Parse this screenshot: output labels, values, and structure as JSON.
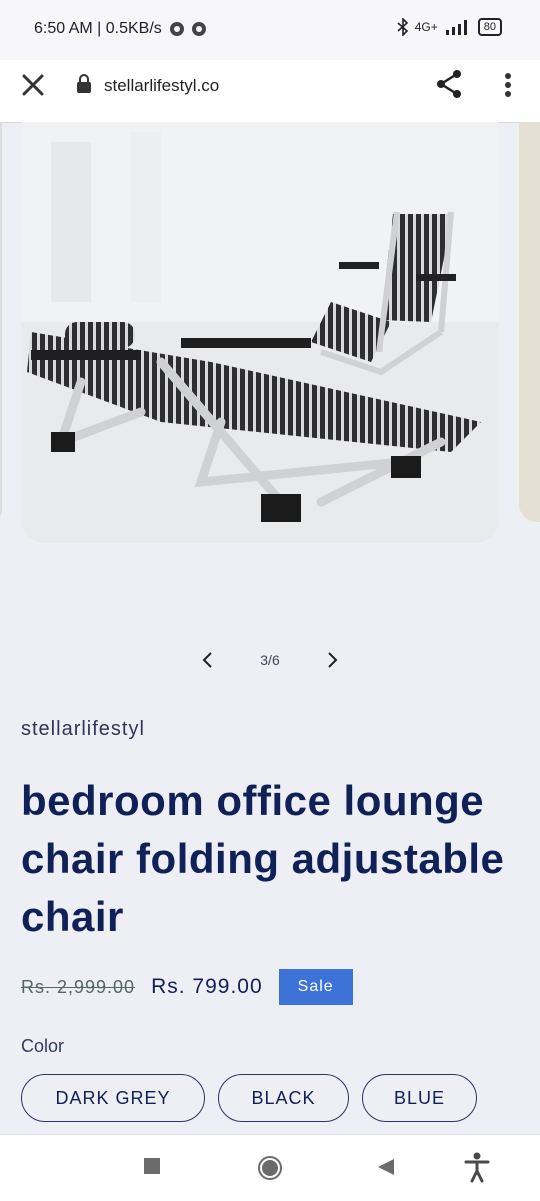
{
  "status_bar": {
    "time": "6:50 AM | 0.5KB/s",
    "network_label": "4G+",
    "battery": "80"
  },
  "browser": {
    "url": "stellarlifestyl.co"
  },
  "gallery": {
    "counter": "3/6",
    "image_alt": "Folding lounge chairs"
  },
  "product": {
    "vendor": "stellarlifestyl",
    "title": "bedroom office lounge chair folding adjustable chair",
    "compare_price": "Rs. 2,999.00",
    "price": "Rs. 799.00",
    "badge": "Sale",
    "color_label": "Color",
    "colors": [
      "DARK GREY",
      "BLACK",
      "BLUE"
    ]
  },
  "icons": {
    "close": "close-icon",
    "lock": "lock-icon",
    "share": "share-icon",
    "menu": "more-vert-icon",
    "prev": "chevron-left-icon",
    "next": "chevron-right-icon"
  },
  "colors": {
    "accent": "#3d72d8",
    "text": "#102157",
    "background": "#eeeff4"
  }
}
